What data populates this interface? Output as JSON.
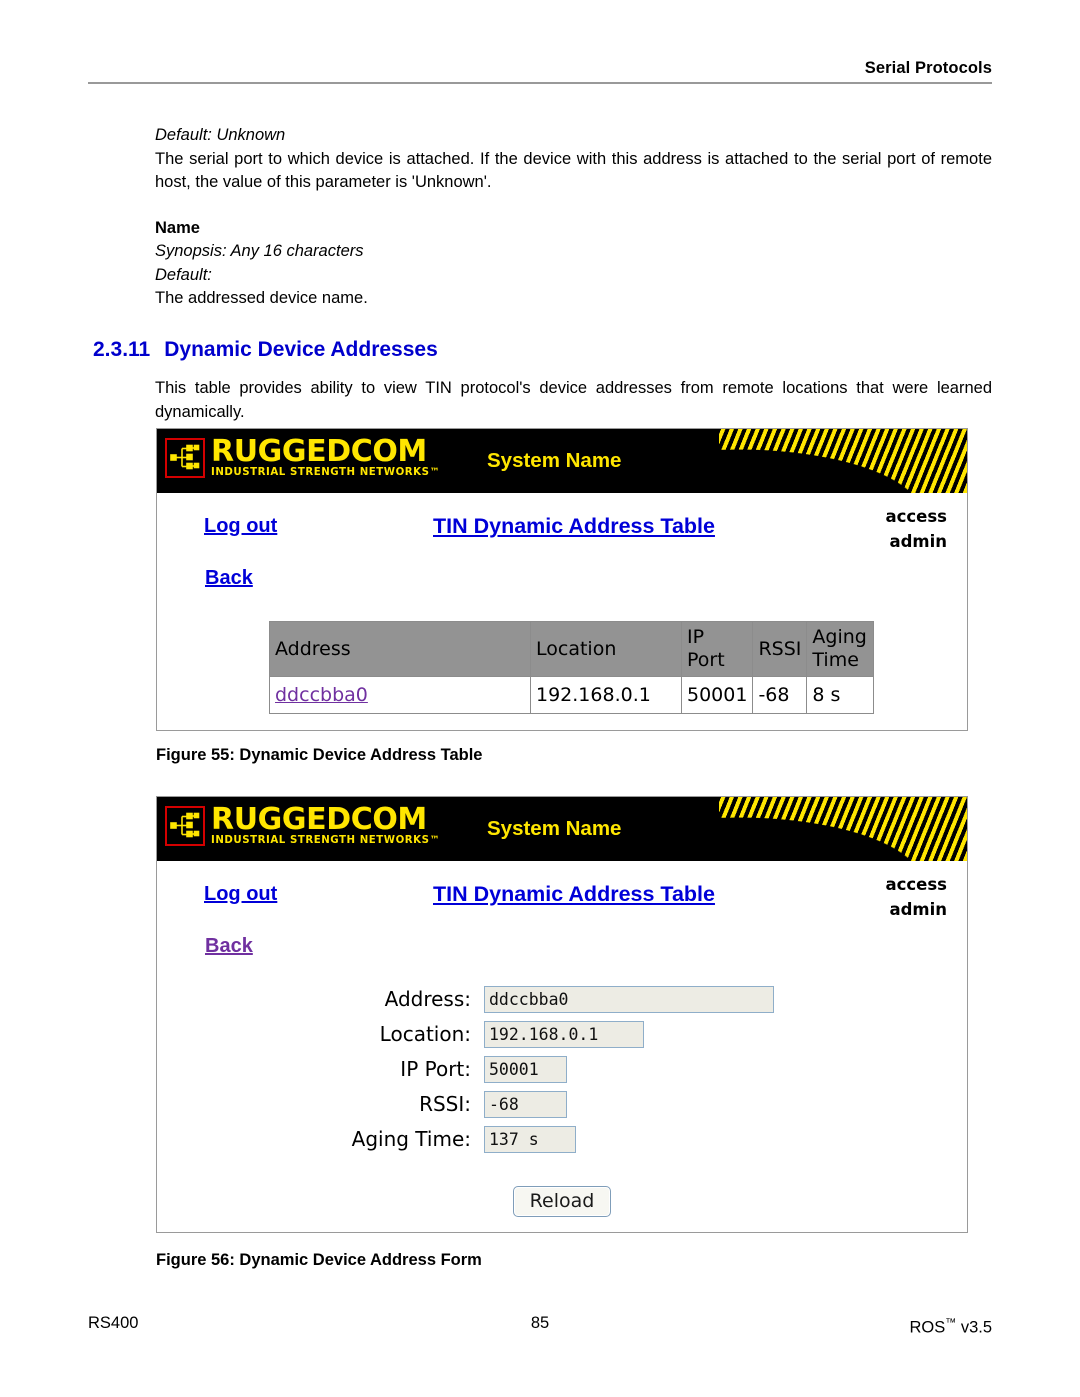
{
  "header": {
    "running_title": "Serial Protocols"
  },
  "body": {
    "default_unknown": "Default: Unknown",
    "serial_port_paragraph": "The serial port to which device is attached. If the device with this address is attached to the serial port of remote host, the value of this parameter is 'Unknown'.",
    "name_heading": "Name",
    "synopsis": "Synopsis: Any 16 characters",
    "default_blank": "Default:",
    "addressed_device_name": "The addressed device name."
  },
  "section": {
    "number": "2.3.11",
    "title": "Dynamic Device Addresses",
    "intro": "This table provides ability to view TIN protocol's device addresses from remote locations that were learned dynamically."
  },
  "figure55": {
    "banner": {
      "logo_title": "RUGGEDCOM",
      "logo_tagline": "INDUSTRIAL STRENGTH NETWORKS™",
      "system_name": "System Name"
    },
    "nav": {
      "logout": "Log out",
      "page_title": "TIN Dynamic Address Table",
      "access_label": "access",
      "access_user": "admin",
      "back": "Back"
    },
    "table": {
      "columns": [
        "Address",
        "Location",
        "IP Port",
        "RSSI",
        "Aging Time"
      ],
      "rows": [
        {
          "address": "ddccbba0",
          "location": "192.168.0.1",
          "ip_port": "50001",
          "rssi": "-68",
          "aging_time": "8 s"
        }
      ]
    },
    "caption": "Figure 55: Dynamic Device Address Table"
  },
  "figure56": {
    "banner": {
      "logo_title": "RUGGEDCOM",
      "logo_tagline": "INDUSTRIAL STRENGTH NETWORKS™",
      "system_name": "System Name"
    },
    "nav": {
      "logout": "Log out",
      "page_title": "TIN Dynamic Address Table",
      "access_label": "access",
      "access_user": "admin",
      "back": "Back"
    },
    "form": {
      "fields": [
        {
          "label": "Address:",
          "value": "ddccbba0"
        },
        {
          "label": "Location:",
          "value": "192.168.0.1"
        },
        {
          "label": "IP Port:",
          "value": "50001"
        },
        {
          "label": "RSSI:",
          "value": "-68"
        },
        {
          "label": "Aging Time:",
          "value": "137 s"
        }
      ],
      "reload_button": "Reload"
    },
    "caption": "Figure 56: Dynamic Device Address Form"
  },
  "footer": {
    "left": "RS400",
    "center": "85",
    "right_text": "ROS",
    "right_tm": "™",
    "right_version": "v3.5"
  },
  "colors": {
    "heading_blue": "#0000cc",
    "link_blue": "#0000d8",
    "link_visited_purple": "#7030a0",
    "banner_black": "#000000",
    "brand_yellow": "#ffe600",
    "logo_red": "#d40000",
    "table_header_gray": "#939393",
    "field_bg": "#edece4",
    "field_border": "#8faec9"
  }
}
